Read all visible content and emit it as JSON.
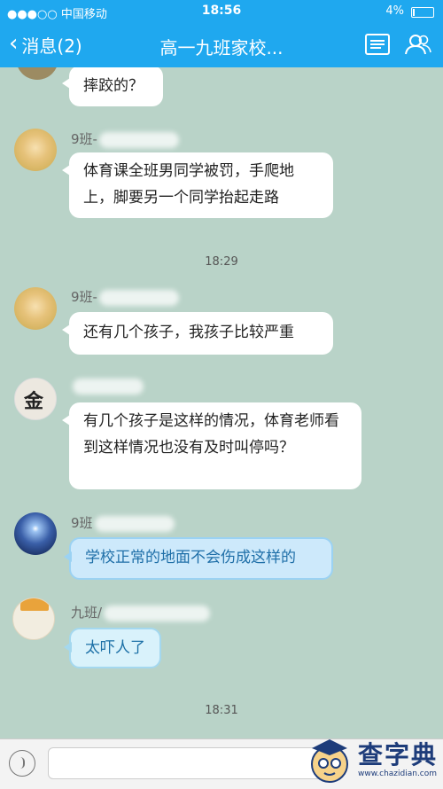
{
  "status": {
    "carrier": "●●●○○ 中国移动",
    "time": "18:56",
    "battery": "4%"
  },
  "nav": {
    "back_label": "消息(2)",
    "title": "高一九班家校..."
  },
  "messages": [
    {
      "sender": "",
      "text": "摔跤的？"
    },
    {
      "sender": "9班-",
      "text": "体育课全班男同学被罚，手爬地上，脚要另一个同学抬起走路"
    },
    {
      "sender": "9班-",
      "text": "还有几个孩子，我孩子比较严重"
    },
    {
      "sender": "",
      "text": "有几个孩子是这样的情况，体育老师看到这样情况也没有及时叫停吗？"
    },
    {
      "sender": "9班",
      "text": "学校正常的地面不会伤成这样的"
    },
    {
      "sender": "九班/",
      "text": "太吓人了"
    }
  ],
  "timestamps": [
    "18:29",
    "18:31"
  ],
  "watermark": {
    "text": "查字典",
    "url": "www.chazidian.com"
  },
  "colors": {
    "header": "#1fa8ef",
    "chat_bg": "#b9d3c8"
  }
}
